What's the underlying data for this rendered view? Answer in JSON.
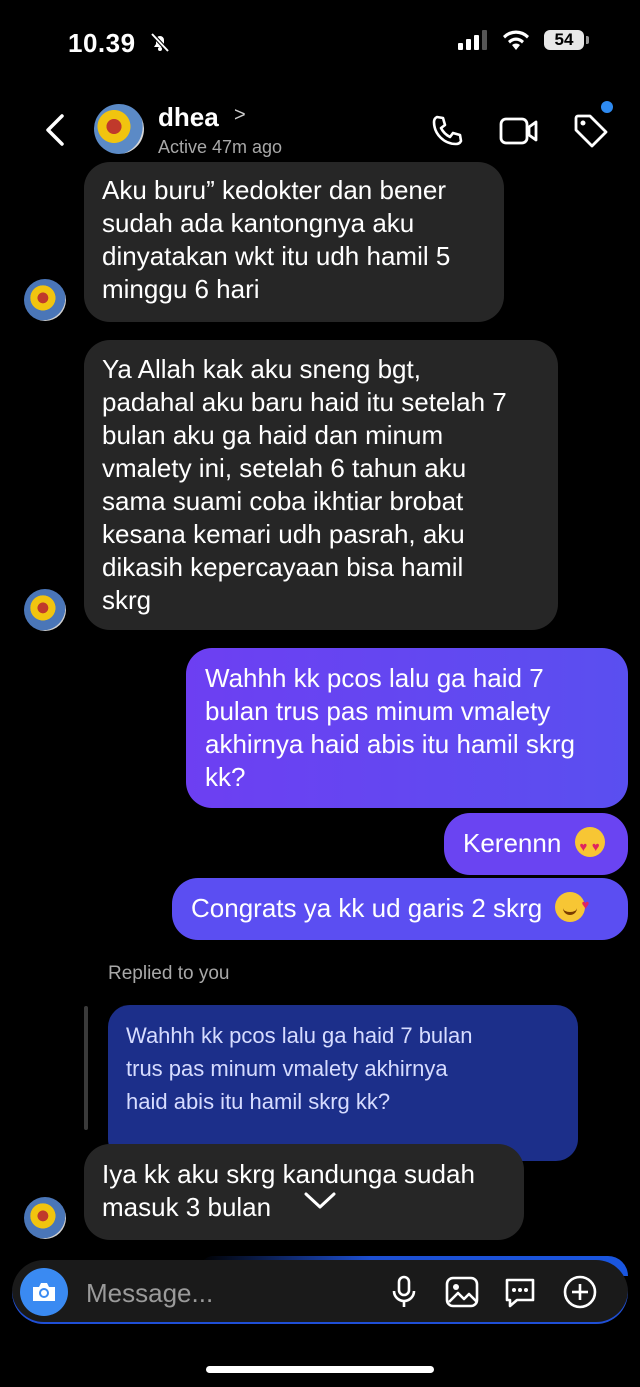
{
  "status_bar": {
    "time": "10.39",
    "battery": "54"
  },
  "header": {
    "name": "dhea",
    "status": "Active 47m ago"
  },
  "messages": {
    "m1": "Aku buru” kedokter dan bener\nsudah ada kantongnya aku\ndinyatakan wkt itu udh hamil 5\nminggu 6 hari",
    "m2": "Ya Allah kak aku sneng bgt,\npadahal aku baru haid itu setelah 7\nbulan aku ga haid dan minum\nvmalety ini, setelah 6 tahun aku\nsama suami coba ikhtiar brobat\nkesana kemari udh pasrah, aku\ndikasih kepercayaan bisa hamil\nskrg",
    "m3": "Wahhh kk pcos lalu ga haid 7\nbulan trus pas minum vmalety\nakhirnya haid abis itu hamil skrg\nkk?",
    "m4": "Kerennn",
    "m5": "Congrats ya kk ud garis 2 skrg",
    "replied_label": "Replied to you",
    "quoted": "Wahhh kk pcos lalu ga haid 7 bulan\ntrus pas minum vmalety akhirnya\nhaid abis itu hamil skrg kk?",
    "m6": "Iya kk aku skrg kandunga sudah\nmasuk 3 bulan"
  },
  "composer": {
    "placeholder": "Message..."
  },
  "colors": {
    "sent_bubble": "#6d3ff2",
    "received_bubble": "#262626",
    "accent": "#3a8af2"
  }
}
